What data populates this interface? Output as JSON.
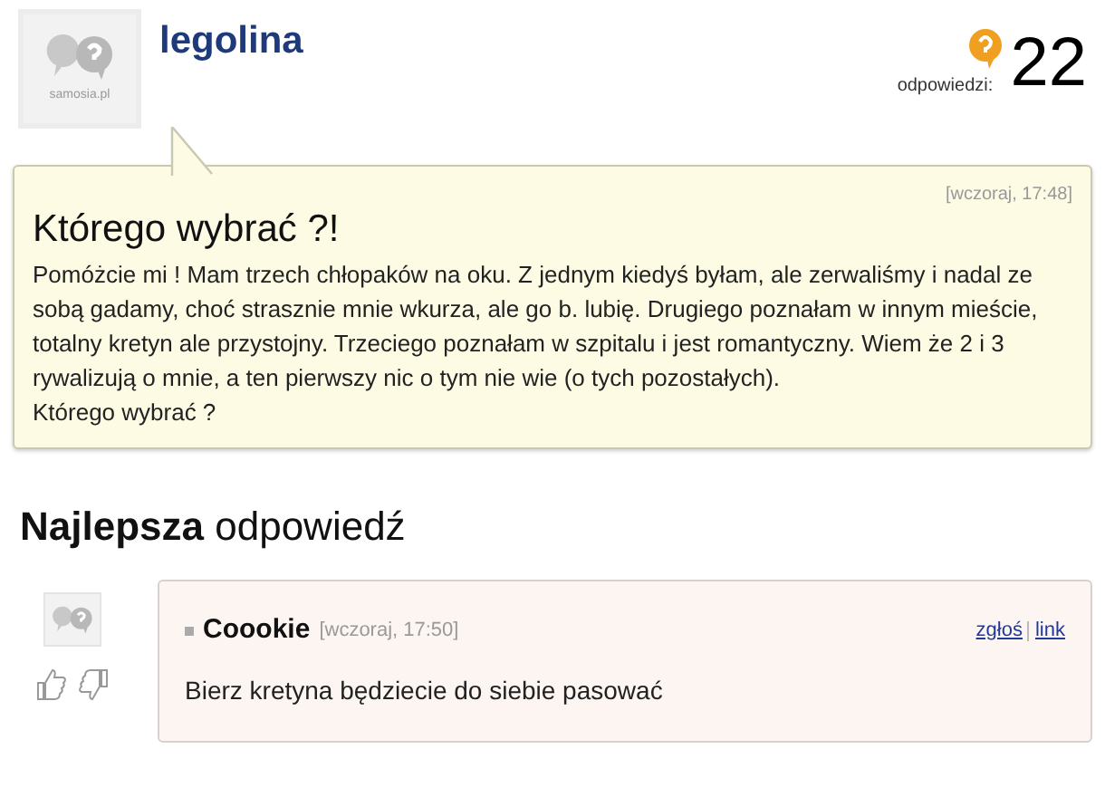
{
  "question": {
    "avatar_caption": "samosia.pl",
    "author": "legolina",
    "answers_label": "odpowiedzi:",
    "answers_count": "22",
    "time": "[wczoraj, 17:48]",
    "title": "Którego wybrać ?!",
    "body": [
      "Pomóżcie mi ! Mam trzech chłopaków na oku. Z jednym kiedyś byłam, ale zerwaliśmy i nadal ze sobą gadamy, choć strasznie mnie wkurza, ale go b. lubię. Drugiego poznałam w innym mieście, totalny kretyn ale przystojny. Trzeciego poznałam w szpitalu i jest romantyczny. Wiem że 2 i 3 rywalizują o mnie, a ten pierwszy nic o tym nie wie (o tych pozostałych).",
      "Którego wybrać ?"
    ]
  },
  "best_answer": {
    "heading": "**Najlepsza** odpowiedź",
    "author": "Coookie",
    "time": "[wczoraj, 17:50]",
    "links": [
      "zgłoś",
      "link"
    ],
    "text": "Bierz kretyna będziecie do siebie pasować"
  }
}
